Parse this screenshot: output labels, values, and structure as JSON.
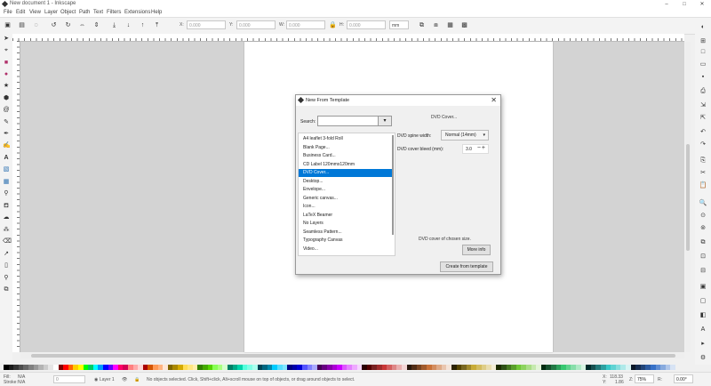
{
  "window": {
    "title": "New document 1 - Inkscape",
    "controls": [
      "–",
      "□",
      "✕"
    ]
  },
  "menu": [
    "File",
    "Edit",
    "View",
    "Layer",
    "Object",
    "Path",
    "Text",
    "Filters",
    "Extensions",
    "Help"
  ],
  "toolbar": {
    "x_label": "X:",
    "x_value": "0.000",
    "y_label": "Y:",
    "y_value": "0.000",
    "w_label": "W:",
    "w_value": "0.000",
    "h_label": "H:",
    "h_value": "0.000",
    "unit": "mm"
  },
  "dialog": {
    "title": "New From Template",
    "close": "✕",
    "search_label": "Search:",
    "search_value": "",
    "search_dropdown": "▾",
    "templates": [
      "A4 leaflet 3-fold Roll",
      "Blank Page...",
      "Business Card...",
      "CD Label 120mmx120mm",
      "DVD Cover...",
      "Desktop...",
      "Envelope...",
      "Generic canvas...",
      "Icon...",
      "LaTeX Beamer",
      "No Layers",
      "Seamless Pattern...",
      "Typography Canvas",
      "Video..."
    ],
    "selected_index": 4,
    "right_title": "DVD Cover...",
    "spine_label": "DVD spine width:",
    "spine_value": "Normal (14mm)",
    "bleed_label": "DVD cover bleed (mm):",
    "bleed_value": "3.0",
    "bleed_controls": "−+",
    "description": "DVD cover of chosen size.",
    "more_info": "More info",
    "create": "Create from template"
  },
  "status": {
    "fill_label": "Fill:",
    "fill_value": "N/A",
    "stroke_label": "Stroke:",
    "stroke_value": "N/A",
    "opacity_value": "0",
    "layer": "Layer 1",
    "message": "No objects selected. Click, Shift+click, Alt+scroll mouse on top of objects, or drag around objects to select.",
    "x_label": "X:",
    "x_value": "118.33",
    "y_label": "Y:",
    "y_value": "1.86",
    "zoom_label": "Z:",
    "zoom_value": "75%",
    "rotation_label": "R:",
    "rotation_value": "0.00°"
  },
  "palette_colors": [
    "#000000",
    "#1a1a1a",
    "#333333",
    "#4d4d4d",
    "#666666",
    "#808080",
    "#999999",
    "#b3b3b3",
    "#cccccc",
    "#e6e6e6",
    "#ffffff",
    "#800000",
    "#ff0000",
    "#ff6600",
    "#ffcc00",
    "#ffff00",
    "#00ff00",
    "#00cc66",
    "#00ffff",
    "#0099ff",
    "#0000ff",
    "#6600ff",
    "#ff00ff",
    "#ff0066",
    "#d40055",
    "#ff8080",
    "#ffaaaa",
    "#ffd5d5",
    "#aa0000",
    "#d45500",
    "#ff9955",
    "#ffb380",
    "#ffe6d5",
    "#806600",
    "#aa8800",
    "#d4aa00",
    "#ffdd55",
    "#ffe680",
    "#ffeeaa",
    "#338000",
    "#44aa00",
    "#55d400",
    "#88ff55",
    "#aaff80",
    "#d5ffcc",
    "#008066",
    "#00aa88",
    "#00d4aa",
    "#55ffdd",
    "#80ffe6",
    "#aaffee",
    "#004455",
    "#006680",
    "#0088aa",
    "#00ccff",
    "#55ddff",
    "#80e5ff",
    "#000080",
    "#0000aa",
    "#0000d4",
    "#5555ff",
    "#8080ff",
    "#aaaaff",
    "#440055",
    "#660080",
    "#8800aa",
    "#aa00d4",
    "#cc00ff",
    "#dd55ff",
    "#e580ff",
    "#eeaaff",
    "#f6d5ff",
    "#2b0000",
    "#550000",
    "#782121",
    "#a02c2c",
    "#c83737",
    "#d35f5f",
    "#de8787",
    "#e9afaf",
    "#f4d7d7",
    "#28170b",
    "#502d16",
    "#784421",
    "#a05a2c",
    "#c87137",
    "#d38d5f",
    "#deaa87",
    "#e9c6af",
    "#f4e3d7",
    "#2b2200",
    "#554400",
    "#786721",
    "#a0892c",
    "#c8ab37",
    "#d3bc5f",
    "#decd87",
    "#e9ddaf",
    "#f4eed7",
    "#1c2b00",
    "#2d5016",
    "#447821",
    "#5aa02c",
    "#71c837",
    "#8dd35f",
    "#aade87",
    "#c6e9af",
    "#e3f4d7",
    "#002b11",
    "#16502d",
    "#217844",
    "#2ca05a",
    "#37c871",
    "#5fd38d",
    "#87deaa",
    "#afe9c6",
    "#d7f4e3",
    "#002b2b",
    "#165050",
    "#217878",
    "#2ca0a0",
    "#37c8c8",
    "#5fd3d3",
    "#87dede",
    "#afe9e9",
    "#d7f4f4",
    "#0b1728",
    "#162d50",
    "#214478",
    "#2c5aa0",
    "#3771c8",
    "#5f8dd3",
    "#87aade",
    "#afc6e9",
    "#d7e3f4"
  ]
}
